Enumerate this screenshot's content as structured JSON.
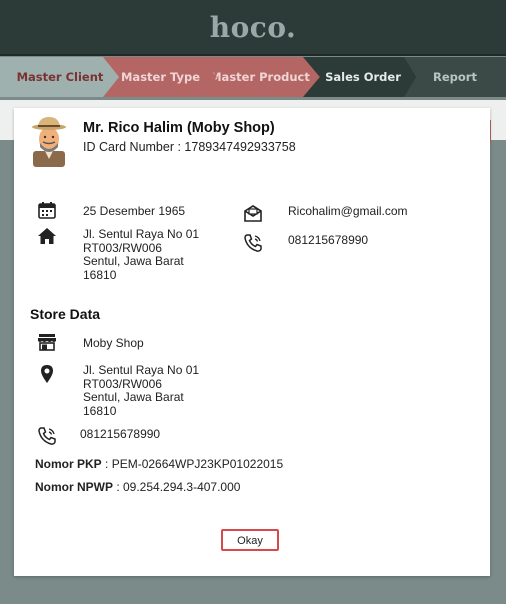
{
  "app": {
    "logo": "hoco."
  },
  "steps": [
    {
      "label": "Master Client"
    },
    {
      "label": "Master Type"
    },
    {
      "label": "Master Product"
    },
    {
      "label": "Sales Order"
    },
    {
      "label": "Report"
    }
  ],
  "client": {
    "name": "Mr. Rico Halim (Moby Shop)",
    "id_card": "ID Card Number : 1789347492933758",
    "birth_date": "25 Desember 1965",
    "address_lines": [
      "Jl. Sentul Raya No 01",
      "RT003/RW006",
      "Sentul, Jawa Barat",
      "16810"
    ],
    "email": "Ricohalim@gmail.com",
    "phone": "081215678990"
  },
  "store": {
    "section_title": "Store Data",
    "name": "Moby Shop",
    "address_lines": [
      "Jl. Sentul Raya No 01",
      "RT003/RW006",
      "Sentul, Jawa Barat",
      "16810"
    ],
    "phone": "081215678990",
    "pkp_label": "Nomor PKP",
    "pkp_value": " : PEM-02664WPJ23KP01022015",
    "npwp_label": "Nomor NPWP",
    "npwp_value": " : 09.254.294.3-407.000"
  },
  "actions": {
    "okay_label": "Okay"
  },
  "colors": {
    "accent": "#b36664",
    "dark": "#2c3b38",
    "okay_border": "#d84a4a"
  }
}
